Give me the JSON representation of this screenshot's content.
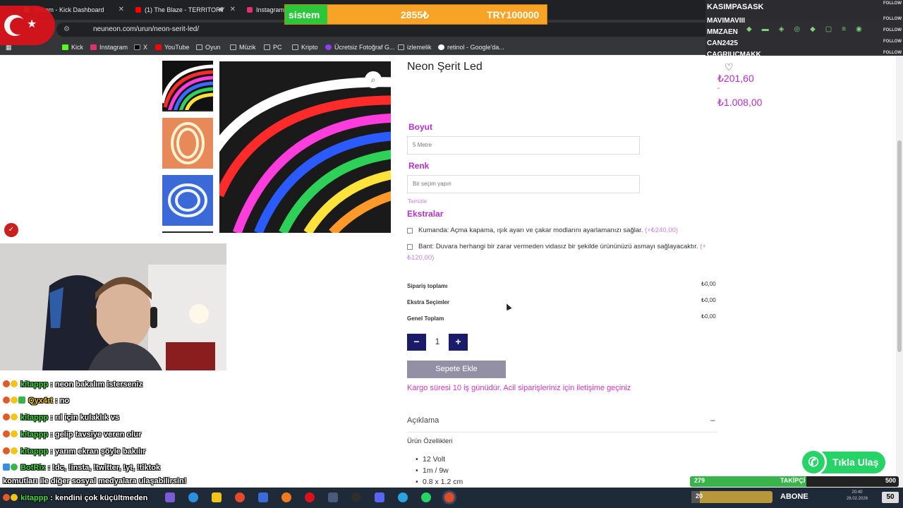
{
  "browser": {
    "tabs": [
      {
        "label": "Stream - Kick Dashboard",
        "color": "#53fc18"
      },
      {
        "label": "(1) The Blaze - TERRITORY",
        "color": "#ff0000"
      },
      {
        "label": "Instagram",
        "color": "#e1306c"
      }
    ],
    "url": "neuneon.com/urun/neon-serit-led/",
    "bookmarks": [
      "Kick",
      "Instagram",
      "X",
      "YouTube",
      "Oyun",
      "Müzik",
      "PC",
      "Kripto",
      "Ücretsiz Fotoğraf G...",
      "izlemelik",
      "retinol - Google'da..."
    ]
  },
  "overlay": {
    "sponsor_name": "sistem",
    "sponsor_amount": "2855₺",
    "sponsor_goal": "TRY100000",
    "followers_title": "KASIMPASASK",
    "followers": [
      "MAVIMAVIII",
      "MMZAEN",
      "CAN2425",
      "CAGRIUCMAKK"
    ],
    "follow_tag": "FOLLOW",
    "follow_goal": {
      "current": "279",
      "label": "TAKİPÇİ",
      "target": "500"
    },
    "sub_goal": {
      "current": "20",
      "label": "ABONE"
    },
    "count_badge": "50",
    "clock_time": "20:40",
    "clock_date": "26.02.2026"
  },
  "product": {
    "title": "Neon Şerit Led",
    "price_min": "₺201,60",
    "price_dash": "-",
    "price_max": "₺1.008,00",
    "size_label": "Boyut",
    "size_value": "5 Metre",
    "color_label": "Renk",
    "color_placeholder": "Bir seçim yapın",
    "clear_label": "Temizle",
    "extras_title": "Ekstralar",
    "extras": [
      {
        "text": "Kumanda: Açma kapama, ışık ayarı ve çakar modlarını ayarlamanızı sağlar.",
        "price": "(+₺240,00)"
      },
      {
        "text": "Bant: Duvara herhangi bir zarar vermeden vidasız bir şekilde ürününüzü asmayı sağlayacaktır.",
        "price": "(+₺120,00)"
      }
    ],
    "totals": [
      {
        "label": "Sipariş toplamı",
        "value": "₺0,00"
      },
      {
        "label": "Ekstra Seçimler",
        "value": "₺0,00"
      },
      {
        "label": "Genel Toplam",
        "value": "₺0,00"
      }
    ],
    "quantity": "1",
    "minus": "−",
    "plus": "+",
    "add_to_cart": "Sepete Ekle",
    "shipping_note": "Kargo süresi 10 iş günüdür. Acil siparişleriniz için iletişime geçiniz",
    "description_label": "Açıklama",
    "features_title": "Ürün Özellikleri",
    "features": [
      "12 Volt",
      "1m / 9w",
      "0.8 x 1.2 cm"
    ]
  },
  "whatsapp_label": "Tıkla Ulaş",
  "chat": [
    {
      "user": "kitappp",
      "msg": ": neon bakalım isterseniz",
      "color": "green"
    },
    {
      "user": "Qyx4rt",
      "msg": ": no",
      "color": "yellow"
    },
    {
      "user": "kitappp",
      "msg": ": rıl için kulaklık vs",
      "color": "green"
    },
    {
      "user": "kitappp",
      "msg": ": gelip tavsiye veren olur",
      "color": "green"
    },
    {
      "user": "kitappp",
      "msg": ": yarım ekran şöyle bakılır",
      "color": "green"
    },
    {
      "user": "BotRix",
      "msg": ": !dc, !insta, !twitter, !yt, !tiktok",
      "color": "green"
    },
    {
      "user": "",
      "msg": "komutları ile diğer sosyal medyalara ulaşabilirsin!",
      "color": "green"
    },
    {
      "user": "kitappp",
      "msg": ": kendini çok küçültmeden",
      "color": "green"
    }
  ]
}
